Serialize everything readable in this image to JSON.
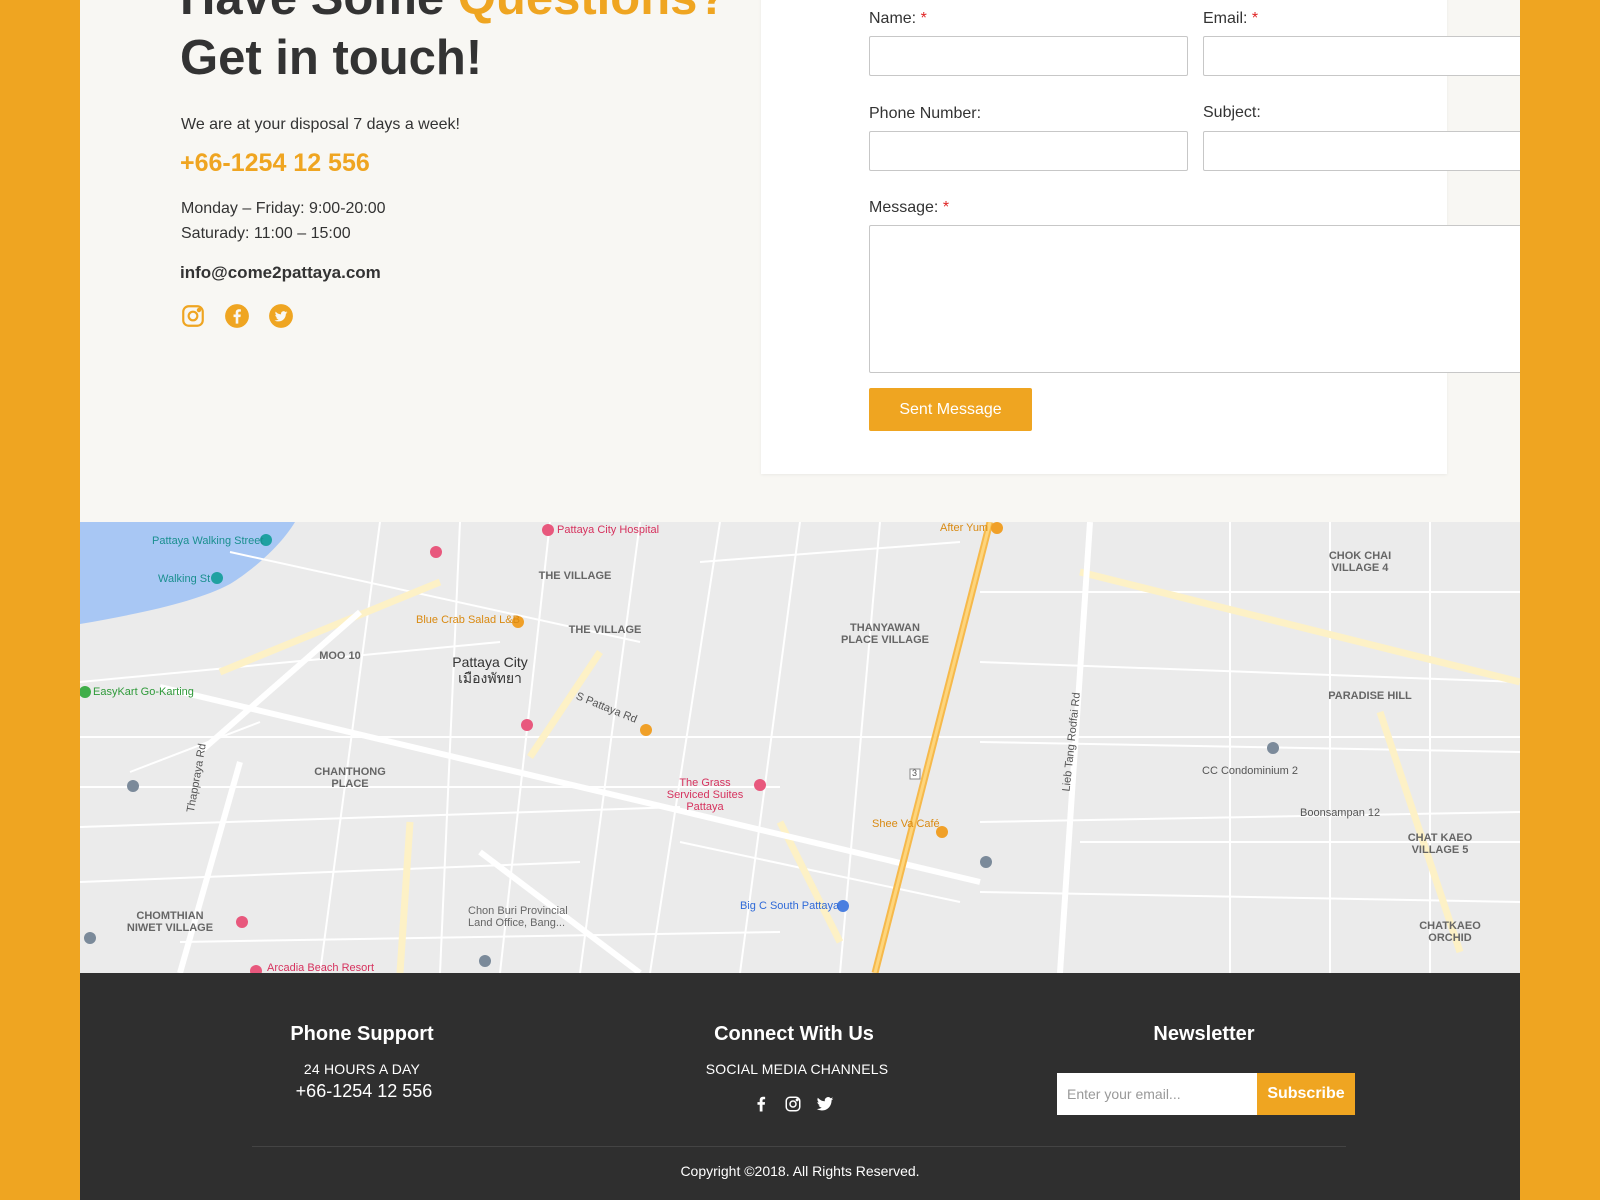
{
  "contact": {
    "heading_line1_a": "Have Some ",
    "heading_line1_b": "Questions?",
    "heading_line2": "Get in touch!",
    "disposal": "We are at your disposal 7 days a week!",
    "phone": "+66-1254 12 556",
    "hours_weekday": "Monday – Friday: 9:00-20:00",
    "hours_saturday": "Saturady: 11:00 – 15:00",
    "email": "info@come2pattaya.com",
    "social_icons": [
      "instagram-icon",
      "facebook-icon",
      "twitter-icon"
    ]
  },
  "form": {
    "name_label": "Name:",
    "email_label": "Email:",
    "phone_label": "Phone Number:",
    "subject_label": "Subject:",
    "message_label": "Message:",
    "required_mark": "*",
    "submit_label": "Sent Message"
  },
  "map": {
    "city_en": "Pattaya City",
    "city_th": "เมืองพัทยา",
    "places": {
      "walking_street": "Pattaya Walking Street",
      "walking_st": "Walking St",
      "hospital": "Pattaya City Hospital",
      "after_yum": "After Yum",
      "blue_crab": "Blue Crab Salad L&B",
      "easykart": "EasyKart Go-Karting",
      "grass": "The Grass Serviced Suites Pattaya",
      "sheeva": "Shee Va Café",
      "bigc": "Big C South Pattaya",
      "cc_condo": "CC Condominium 2",
      "arcadia": "Arcadia Beach Resort",
      "land_office": "Chon Buri Provincial Land Office, Bang...",
      "the_village": "THE VILLAGE",
      "thanyawan": "THANYAWAN PLACE VILLAGE",
      "chok_chai": "CHOK CHAI VILLAGE 4",
      "paradise": "PARADISE HILL",
      "chanthong": "CHANTHONG PLACE",
      "chomthian": "CHOMTHIAN NIWET VILLAGE",
      "chat_kaeo": "CHAT KAEO VILLAGE 5",
      "chatkaeo_orchid": "CHATKAEO ORCHID",
      "moo10": "MOO 10",
      "s_pattaya_rd": "S Pattaya Rd",
      "thepprasit": "Thappraya Rd",
      "lieb_tang": "Lieb Tang Rodfai Rd",
      "boonsampan": "Boonsampan 12",
      "route": "3"
    }
  },
  "footer": {
    "phone_title": "Phone Support",
    "phone_sub": "24 HOURS A DAY",
    "phone_number": "+66-1254 12 556",
    "connect_title": "Connect With Us",
    "connect_sub": "SOCIAL MEDIA CHANNELS",
    "social_icons": [
      "facebook-icon",
      "instagram-icon",
      "twitter-icon"
    ],
    "newsletter_title": "Newsletter",
    "newsletter_placeholder": "Enter your email...",
    "subscribe_label": "Subscribe",
    "copyright": "Copyright ©2018. All Rights Reserved."
  },
  "colors": {
    "accent": "#efa521",
    "footer_bg": "#2f2f2f",
    "page_bg": "#f8f7f3",
    "required": "#e02424"
  }
}
